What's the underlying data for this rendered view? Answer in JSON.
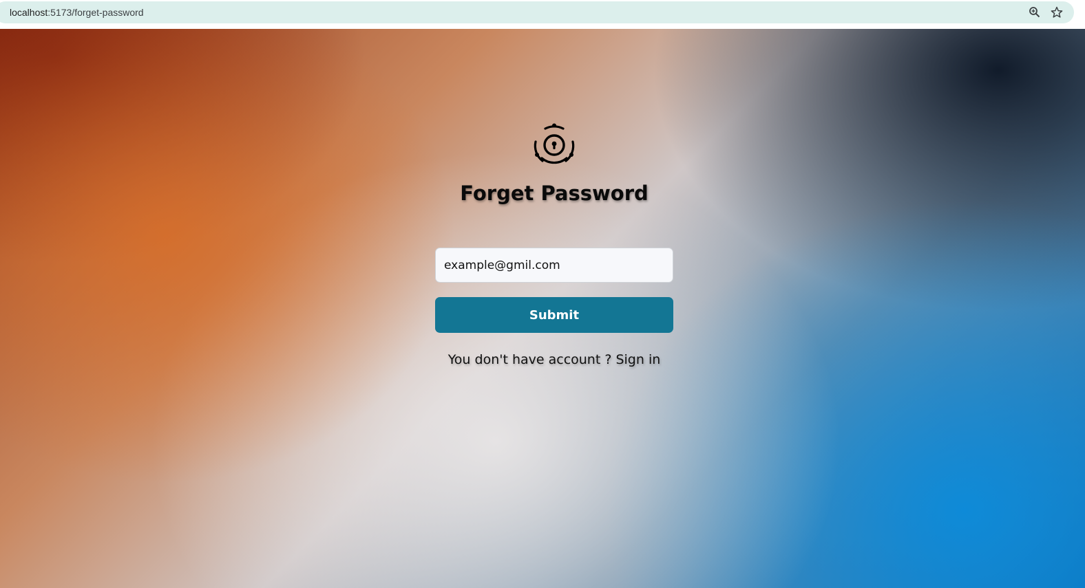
{
  "browser": {
    "url_host": "localhost",
    "url_path": ":5173/forget-password"
  },
  "icons": {
    "logo": "lock-orbit-icon",
    "zoom": "zoom-icon",
    "bookmark": "star-icon"
  },
  "form": {
    "title": "Forget Password",
    "email_placeholder": "example@gmil.com",
    "submit_label": "Submit",
    "signin_prompt": "You don't have account ? ",
    "signin_link": "Sign in"
  },
  "colors": {
    "button": "#137694",
    "omnibox": "#dcefec"
  }
}
